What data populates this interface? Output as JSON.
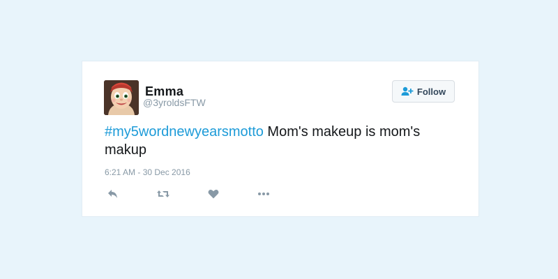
{
  "tweet": {
    "user": {
      "display_name": "Emma",
      "handle": "@3yroldsFTW",
      "avatar_icon": "cartoon-avatar"
    },
    "follow_button": {
      "label": "Follow",
      "icon": "add-user-icon"
    },
    "text": {
      "hashtag": "#my5wordnewyearsmotto",
      "body": " Mom's makeup is mom's makup"
    },
    "timestamp": "6:21 AM - 30 Dec 2016",
    "actions": [
      {
        "name": "reply",
        "icon": "reply-icon"
      },
      {
        "name": "retweet",
        "icon": "retweet-icon"
      },
      {
        "name": "like",
        "icon": "heart-icon"
      },
      {
        "name": "more",
        "icon": "more-icon"
      }
    ]
  },
  "colors": {
    "background": "#e8f4fb",
    "hashtag": "#1d9bd8",
    "muted": "#8899a6",
    "icon": "#8899a6"
  }
}
